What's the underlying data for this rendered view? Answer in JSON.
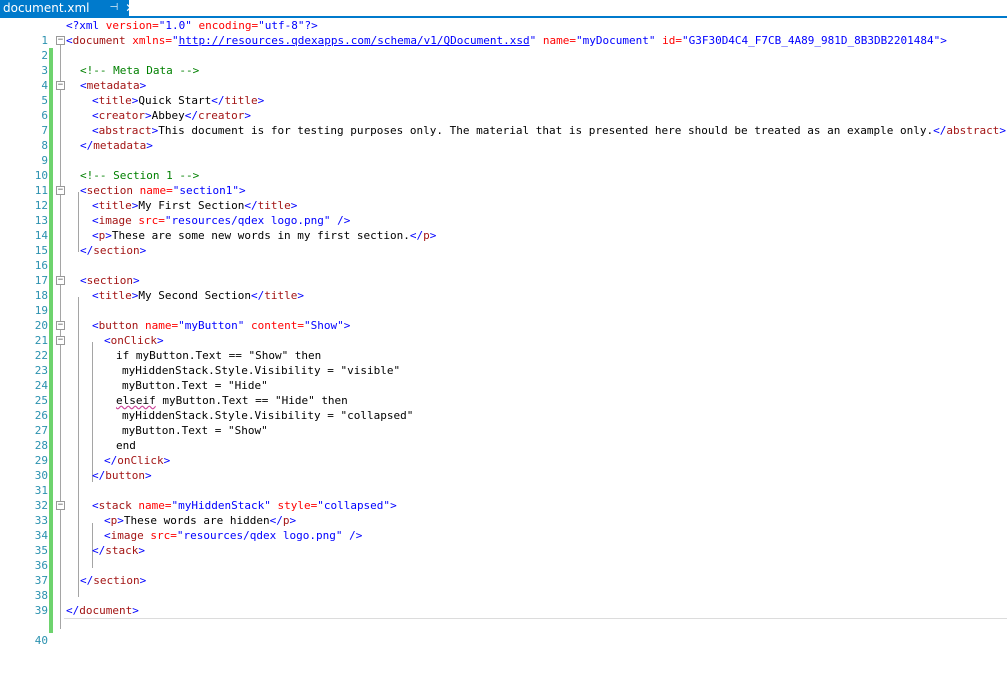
{
  "tab": {
    "title": "document.xml",
    "pin_icon": "pin-icon",
    "close_icon": "close-icon"
  },
  "lines": [
    {
      "n": "1"
    },
    {
      "n": "2"
    },
    {
      "n": "3"
    },
    {
      "n": "4"
    },
    {
      "n": "5"
    },
    {
      "n": "6"
    },
    {
      "n": "7"
    },
    {
      "n": "8"
    },
    {
      "n": "9"
    },
    {
      "n": "10"
    },
    {
      "n": "11"
    },
    {
      "n": "12"
    },
    {
      "n": "13"
    },
    {
      "n": "14"
    },
    {
      "n": "15"
    },
    {
      "n": "16"
    },
    {
      "n": "17"
    },
    {
      "n": "18"
    },
    {
      "n": "19"
    },
    {
      "n": "20"
    },
    {
      "n": "21"
    },
    {
      "n": "22"
    },
    {
      "n": "23"
    },
    {
      "n": "24"
    },
    {
      "n": "25"
    },
    {
      "n": "26"
    },
    {
      "n": "27"
    },
    {
      "n": "28"
    },
    {
      "n": "29"
    },
    {
      "n": "30"
    },
    {
      "n": "31"
    },
    {
      "n": "32"
    },
    {
      "n": "33"
    },
    {
      "n": "34"
    },
    {
      "n": "35"
    },
    {
      "n": "36"
    },
    {
      "n": "37"
    },
    {
      "n": "38"
    },
    {
      "n": "39"
    },
    {
      "n": "40"
    }
  ],
  "code": {
    "l1": {
      "pi": "<?xml",
      "a1": " version=",
      "v1": "\"1.0\"",
      "a2": " encoding=",
      "v2": "\"utf-8\"",
      "end": "?>"
    },
    "l2": {
      "open": "<",
      "tag": "document",
      "a1": " xmlns=",
      "q1": "\"",
      "url": "http://resources.qdexapps.com/schema/v1/QDocument.xsd",
      "q2": "\"",
      "a2": " name=",
      "v2": "\"myDocument\"",
      "a3": " id=",
      "v3": "\"G3F30D4C4_F7CB_4A89_981D_8B3DB2201484\"",
      "close": ">"
    },
    "l4": {
      "c": "<!-- Meta Data -->"
    },
    "l5": {
      "tag": "metadata"
    },
    "l6": {
      "tag": "title",
      "text": "Quick Start"
    },
    "l7": {
      "tag": "creator",
      "text": "Abbey"
    },
    "l8": {
      "tag": "abstract",
      "text": "This document is for testing purposes only. The material that is presented here should be treated as an example only."
    },
    "l9": {
      "tag": "metadata"
    },
    "l11": {
      "c": "<!-- Section 1 -->"
    },
    "l12": {
      "tag": "section",
      "a1": " name=",
      "v1": "\"section1\""
    },
    "l13": {
      "tag": "title",
      "text": "My First Section"
    },
    "l14": {
      "tag": "image",
      "a1": " src=",
      "v1": "\"resources/qdex logo.png\"",
      "end": " />"
    },
    "l15": {
      "tag": "p",
      "text": "These are some new words in my first section."
    },
    "l16": {
      "tag": "section"
    },
    "l18": {
      "tag": "section"
    },
    "l19": {
      "tag": "title",
      "text": "My Second Section"
    },
    "l21": {
      "tag": "button",
      "a1": " name=",
      "v1": "\"myButton\"",
      "a2": " content=",
      "v2": "\"Show\""
    },
    "l22": {
      "tag": "onClick"
    },
    "l23": {
      "text": "if myButton.Text == \"Show\" then"
    },
    "l24": {
      "text": "myHiddenStack.Style.Visibility = \"visible\""
    },
    "l25": {
      "text": "myButton.Text = \"Hide\""
    },
    "l26": {
      "kw": "elseif",
      "text": " myButton.Text == \"Hide\" then"
    },
    "l27": {
      "text": "myHiddenStack.Style.Visibility = \"collapsed\""
    },
    "l28": {
      "text": "myButton.Text = \"Show\""
    },
    "l29": {
      "text": "end"
    },
    "l30": {
      "tag": "onClick"
    },
    "l31": {
      "tag": "button"
    },
    "l33": {
      "tag": "stack",
      "a1": " name=",
      "v1": "\"myHiddenStack\"",
      "a2": " style=",
      "v2": "\"collapsed\""
    },
    "l34": {
      "tag": "p",
      "text": "These words are hidden"
    },
    "l35": {
      "tag": "image",
      "a1": " src=",
      "v1": "\"resources/qdex logo.png\"",
      "end": " />"
    },
    "l36": {
      "tag": "stack"
    },
    "l38": {
      "tag": "section"
    },
    "l40": {
      "tag": "document"
    }
  }
}
